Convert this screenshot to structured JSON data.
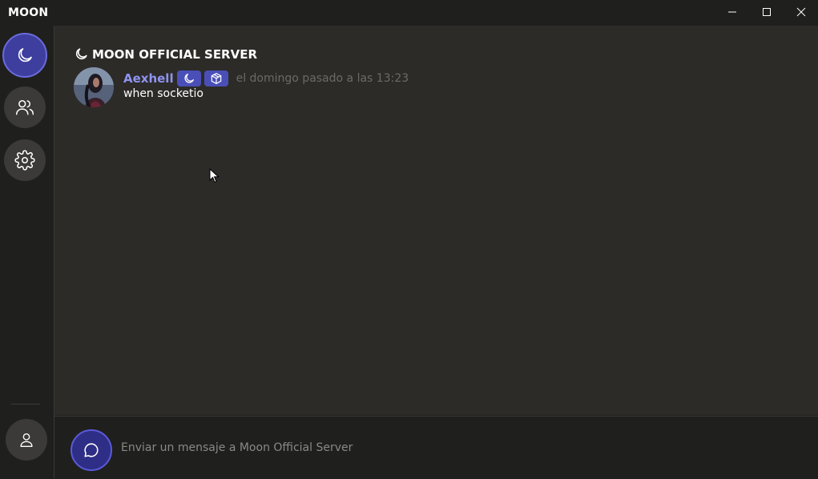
{
  "app": {
    "title": "MOON"
  },
  "window_controls": [
    "minimize-icon",
    "maximize-icon",
    "close-icon"
  ],
  "sidebar": {
    "items": [
      {
        "name": "servers",
        "icon": "moon-icon",
        "active": true
      },
      {
        "name": "friends",
        "icon": "users-icon",
        "active": false
      },
      {
        "name": "settings",
        "icon": "gear-icon",
        "active": false
      }
    ],
    "profile": {
      "icon": "user-icon"
    }
  },
  "channel": {
    "icon": "moon-icon",
    "title": "MOON OFFICIAL SERVER"
  },
  "messages": [
    {
      "author": "Aexhell",
      "badges": [
        "moon-icon",
        "cube-icon"
      ],
      "timestamp": "el domingo pasado a las 13:23",
      "text": "when socketio"
    }
  ],
  "composer": {
    "placeholder": "Enviar un mensaje a Moon Official Server",
    "value": "",
    "send_icon": "chat-bubble-icon"
  },
  "colors": {
    "accent": "#3e3e9e",
    "author": "#8f93f0",
    "badge": "#4a4fb8",
    "background": "#2c2b28",
    "sidebar": "#1f1f1e"
  }
}
